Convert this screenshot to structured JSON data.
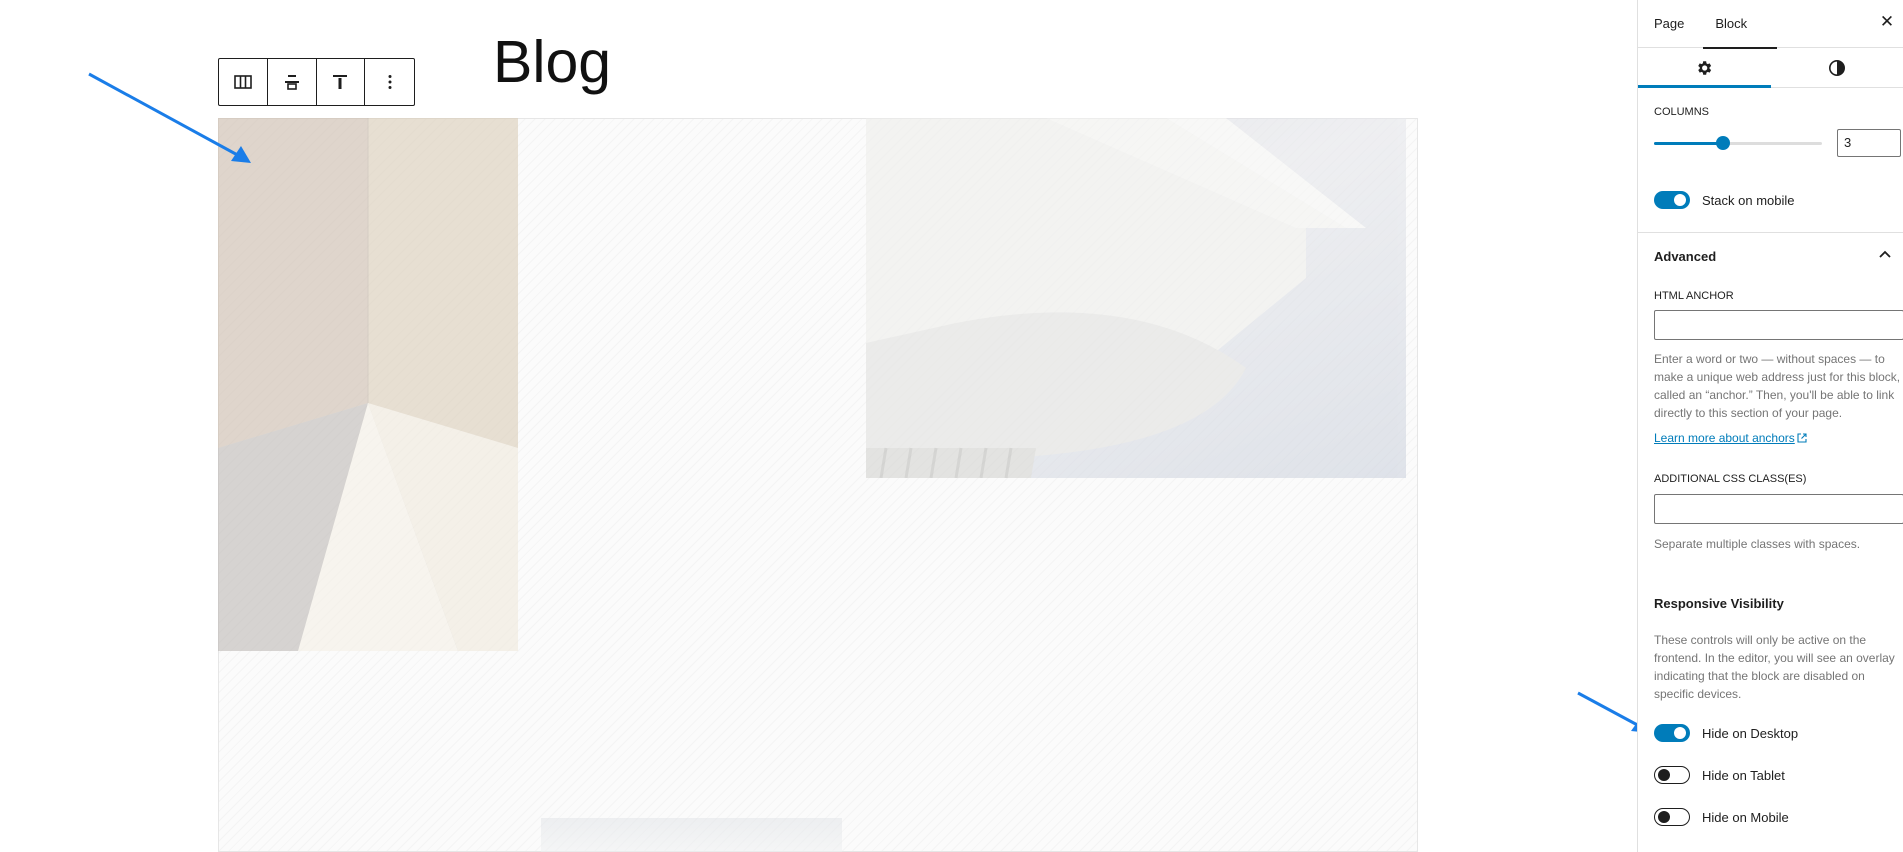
{
  "editor": {
    "page_title": "Blog"
  },
  "toolbar": {
    "buttons": [
      "columns",
      "align-center",
      "align-top",
      "more-options"
    ]
  },
  "sidebar": {
    "tabs": [
      "Page",
      "Block"
    ],
    "active_tab": "Block",
    "close_symbol": "✕",
    "subtabs": [
      "settings-gear",
      "styles-contrast"
    ],
    "columns": {
      "label": "COLUMNS",
      "value": "3",
      "slider_fraction": 0.41
    },
    "stack_on_mobile": {
      "label": "Stack on mobile",
      "on": true
    },
    "advanced": {
      "heading": "Advanced",
      "html_anchor_label": "HTML ANCHOR",
      "html_anchor_value": "",
      "anchor_help": "Enter a word or two — without spaces — to make a unique web address just for this block, called an “anchor.” Then, you'll be able to link directly to this section of your page.",
      "anchor_link": "Learn more about anchors",
      "css_class_label": "ADDITIONAL CSS CLASS(ES)",
      "css_class_value": "",
      "css_class_help": "Separate multiple classes with spaces."
    },
    "responsive": {
      "heading": "Responsive Visibility",
      "help": "These controls will only be active on the frontend. In the editor, you will see an overlay indicating that the block are disabled on specific devices.",
      "toggles": [
        {
          "label": "Hide on Desktop",
          "on": true
        },
        {
          "label": "Hide on Tablet",
          "on": false
        },
        {
          "label": "Hide on Mobile",
          "on": false
        }
      ]
    }
  },
  "colors": {
    "accent": "#007cba",
    "annotation_arrow": "#1a7de8"
  }
}
